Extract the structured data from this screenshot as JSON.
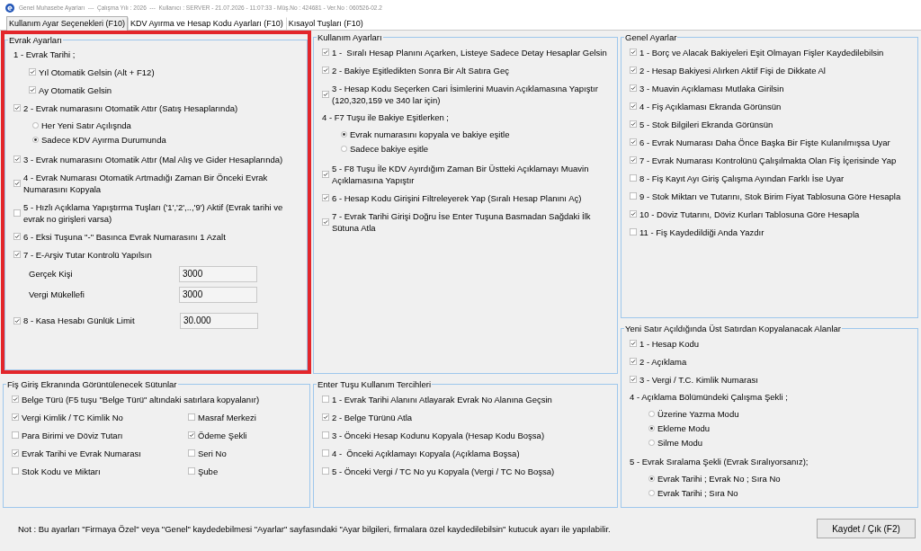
{
  "window": {
    "title": "Genel Muhasebe Ayarları  ---  Çalışma Yılı : 2026  ---  Kullanıcı : SERVER - 21.07.2026 - 11:07:33 - Müş.No : 424681 - Ver.No : 060526-02.2"
  },
  "tabs": [
    {
      "label": "Kullanım Ayar Seçenekleri (F10)",
      "selected": true
    },
    {
      "label": "KDV Ayırma ve Hesap Kodu Ayarları (F10)",
      "selected": false
    },
    {
      "label": "Kısayol Tuşları (F10)",
      "selected": false
    }
  ],
  "columns": [
    {
      "groups": [
        {
          "title": "Evrak Ayarları",
          "highlighted": true,
          "items": [
            {
              "kind": "heading",
              "label": "1 - Evrak Tarihi ;",
              "children": [
                {
                  "kind": "checkbox",
                  "label": "Yıl Otomatik Gelsin (Alt + F12)",
                  "checked": true
                },
                {
                  "kind": "checkbox",
                  "label": "Ay Otomatik Gelsin",
                  "checked": true
                }
              ]
            },
            {
              "kind": "checkbox",
              "label": "2 - Evrak numarasını Otomatik Attır (Satış Hesaplarında)",
              "checked": true,
              "children": [
                {
                  "kind": "radio",
                  "label": "Her Yeni Satır Açılışnda",
                  "selected": false
                },
                {
                  "kind": "radio",
                  "label": "Sadece KDV Ayırma Durumunda",
                  "selected": true
                }
              ]
            },
            {
              "kind": "checkbox",
              "label": "3 - Evrak numarasını Otomatik Attır (Mal Alış ve Gider Hesaplarında)",
              "checked": true
            },
            {
              "kind": "checkbox",
              "label": "4 - Evrak Numarası Otomatik Artmadığı Zaman Bir Önceki Evrak Numarasını Kopyala",
              "checked": true
            },
            {
              "kind": "checkbox",
              "label": "5 - Hızlı Açıklama Yapıştırma Tuşları ('1','2',..,'9') Aktif (Evrak tarihi ve evrak no girişleri varsa)",
              "checked": false
            },
            {
              "kind": "checkbox",
              "label": "6 - Eksi Tuşuna \"-\" Basınca Evrak Numarasını 1 Azalt",
              "checked": true
            },
            {
              "kind": "checkbox",
              "label": "7 - E-Arşiv Tutar Kontrolü Yapılsın",
              "checked": true,
              "children": [
                {
                  "kind": "field",
                  "label": "Gerçek Kişi",
                  "value": "3000"
                },
                {
                  "kind": "field",
                  "label": "Vergi Mükellefi",
                  "value": "3000"
                }
              ]
            },
            {
              "kind": "checkbox",
              "label": "8 - Kasa Hesabı Günlük Limit",
              "checked": true,
              "value": "30.000"
            }
          ]
        },
        {
          "title": "Fiş Giriş Ekranında Görüntülenecek Sütunlar",
          "highlighted": false,
          "items": [
            {
              "kind": "checkbox",
              "label": "Belge Türü (F5 tuşu \"Belge Türü\" altındaki satırlara kopyalanır)",
              "checked": true
            }
          ],
          "grid": [
            {
              "kind": "checkbox",
              "label": "Vergi Kimlik / TC Kimlik No",
              "checked": true
            },
            {
              "kind": "checkbox",
              "label": "Masraf Merkezi",
              "checked": false
            },
            {
              "kind": "checkbox",
              "label": "Para Birimi ve Döviz Tutarı",
              "checked": false
            },
            {
              "kind": "checkbox",
              "label": "Ödeme Şekli",
              "checked": true
            },
            {
              "kind": "checkbox",
              "label": "Evrak Tarihi ve Evrak Numarası",
              "checked": true
            },
            {
              "kind": "checkbox",
              "label": "Seri No",
              "checked": false
            },
            {
              "kind": "checkbox",
              "label": "Stok Kodu ve Miktarı",
              "checked": false
            },
            {
              "kind": "checkbox",
              "label": "Şube",
              "checked": false
            }
          ]
        }
      ]
    },
    {
      "groups": [
        {
          "title": "Kullanım Ayarları",
          "highlighted": false,
          "items": [
            {
              "kind": "checkbox",
              "label": "1 -  Sıralı Hesap Planını Açarken, Listeye Sadece Detay Hesaplar Gelsin",
              "checked": true
            },
            {
              "kind": "checkbox",
              "label": "2 - Bakiye Eşitledikten Sonra Bir Alt Satıra Geç",
              "checked": true
            },
            {
              "kind": "checkbox",
              "label": "3 - Hesap Kodu Seçerken Cari İsimlerini Muavin Açıklamasına Yapıştır (120,320,159 ve 340 lar için)",
              "checked": true
            },
            {
              "kind": "heading",
              "label": "4 - F7 Tuşu ile Bakiye Eşitlerken ;",
              "children": [
                {
                  "kind": "radio",
                  "label": "Evrak numarasını kopyala ve bakiye eşitle",
                  "selected": true
                },
                {
                  "kind": "radio",
                  "label": "Sadece bakiye eşitle",
                  "selected": false
                }
              ]
            },
            {
              "kind": "checkbox",
              "label": "5 - F8 Tuşu İle KDV Ayırdığım Zaman Bir Üstteki Açıklamayı Muavin Açıklamasına Yapıştır",
              "checked": true
            },
            {
              "kind": "checkbox",
              "label": "6 - Hesap Kodu Girişini Filtreleyerek Yap (Sıralı Hesap Planını Aç)",
              "checked": true
            },
            {
              "kind": "checkbox",
              "label": "7 - Evrak Tarihi Girişi Doğru İse Enter Tuşuna Basmadan Sağdaki İlk Sütuna Atla",
              "checked": true
            }
          ]
        },
        {
          "title": "Enter Tuşu Kullanım Tercihleri",
          "highlighted": false,
          "items": [
            {
              "kind": "checkbox",
              "label": "1 - Evrak Tarihi Alanını Atlayarak Evrak No Alanına Geçsin",
              "checked": false
            },
            {
              "kind": "checkbox",
              "label": "2 - Belge Türünü Atla",
              "checked": true
            },
            {
              "kind": "checkbox",
              "label": "3 - Önceki Hesap Kodunu Kopyala (Hesap Kodu Boşsa)",
              "checked": false
            },
            {
              "kind": "checkbox",
              "label": "4 -  Önceki Açıklamayı Kopyala (Açıklama Boşsa)",
              "checked": false
            },
            {
              "kind": "checkbox",
              "label": "5 - Önceki Vergi / TC No yu Kopyala (Vergi / TC No Boşsa)",
              "checked": false
            }
          ]
        }
      ]
    },
    {
      "groups": [
        {
          "title": "Genel Ayarlar",
          "highlighted": false,
          "items": [
            {
              "kind": "checkbox",
              "label": "1 - Borç ve Alacak Bakiyeleri Eşit Olmayan Fişler Kaydedilebilsin",
              "checked": true
            },
            {
              "kind": "checkbox",
              "label": "2 - Hesap Bakiyesi Alırken Aktif Fişi de Dikkate Al",
              "checked": true
            },
            {
              "kind": "checkbox",
              "label": "3 - Muavin Açıklaması Mutlaka Girilsin",
              "checked": true
            },
            {
              "kind": "checkbox",
              "label": "4 - Fiş Açıklaması Ekranda Görünsün",
              "checked": true
            },
            {
              "kind": "checkbox",
              "label": "5 - Stok Bilgileri Ekranda Görünsün",
              "checked": true
            },
            {
              "kind": "checkbox",
              "label": "6 - Evrak Numarası Daha Önce Başka Bir Fişte Kulanılmışsa Uyar",
              "checked": true
            },
            {
              "kind": "checkbox",
              "label": "7 - Evrak Numarası Kontrolünü Çalışılmakta Olan Fiş İçerisinde Yap",
              "checked": true
            },
            {
              "kind": "checkbox",
              "label": "8 - Fiş Kayıt Ayı Giriş Çalışma Ayından Farklı İse Uyar",
              "checked": false
            },
            {
              "kind": "checkbox",
              "label": "9 - Stok Miktarı ve Tutarını, Stok Birim Fiyat Tablosuna Göre Hesapla",
              "checked": false
            },
            {
              "kind": "checkbox",
              "label": "10 - Döviz Tutarını, Döviz Kurları Tablosuna Göre Hesapla",
              "checked": true
            },
            {
              "kind": "checkbox",
              "label": "11 - Fiş Kaydedildiği Anda Yazdır",
              "checked": false
            }
          ]
        },
        {
          "title": "Yeni Satır Açıldığında Üst Satırdan Kopyalanacak Alanlar",
          "highlighted": false,
          "items": [
            {
              "kind": "checkbox",
              "label": "1 - Hesap Kodu",
              "checked": true
            },
            {
              "kind": "checkbox",
              "label": "2 - Açıklama",
              "checked": true
            },
            {
              "kind": "checkbox",
              "label": "3 - Vergi / T.C. Kimlik Numarası",
              "checked": true
            },
            {
              "kind": "heading",
              "label": "4 - Açıklama Bölümündeki Çalışma Şekli ;",
              "children": [
                {
                  "kind": "radio",
                  "label": "Üzerine Yazma Modu",
                  "selected": false
                },
                {
                  "kind": "radio",
                  "label": "Ekleme Modu",
                  "selected": true
                },
                {
                  "kind": "radio",
                  "label": "Silme Modu",
                  "selected": false
                }
              ]
            },
            {
              "kind": "heading",
              "label": "5 - Evrak Sıralama Şekli (Evrak Sıralıyorsanız);",
              "children": [
                {
                  "kind": "radio",
                  "label": "Evrak Tarihi ; Evrak No ; Sıra No",
                  "selected": true
                },
                {
                  "kind": "radio",
                  "label": "Evrak Tarihi ; Sıra No",
                  "selected": false
                }
              ]
            }
          ]
        }
      ]
    }
  ],
  "footer": {
    "note": "Not : Bu ayarları \"Firmaya Özel\" veya \"Genel\" kaydedebilmesi \"Ayarlar\" sayfasındaki \"Ayar bilgileri, firmalara özel kaydedilebilsin\" kutucuk ayarı ile yapılabilir.",
    "save_button": "Kaydet / Çık (F2)"
  }
}
